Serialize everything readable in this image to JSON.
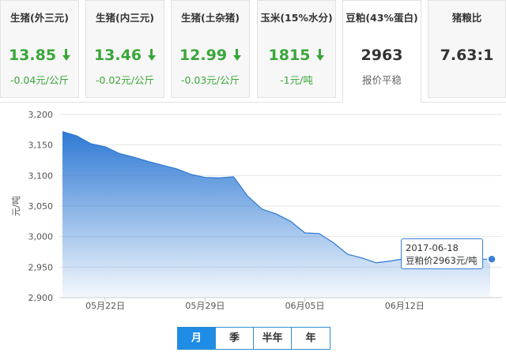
{
  "cards": [
    {
      "title": "生猪(外三元)",
      "value": "13.85",
      "change": "-0.04元/公斤",
      "trend": "down"
    },
    {
      "title": "生猪(内三元)",
      "value": "13.46",
      "change": "-0.02元/公斤",
      "trend": "down"
    },
    {
      "title": "生猪(土杂猪)",
      "value": "12.99",
      "change": "-0.03元/公斤",
      "trend": "down"
    },
    {
      "title": "玉米(15%水分)",
      "value": "1815",
      "change": "-1元/吨",
      "trend": "down"
    },
    {
      "title": "豆粕(43%蛋白)",
      "value": "2963",
      "change": "报价平稳",
      "trend": "flat"
    },
    {
      "title": "猪粮比",
      "value": "7.63:1",
      "change": "",
      "trend": "flat"
    }
  ],
  "tooltip": {
    "date": "2017-06-18",
    "text": "豆粕价2963元/吨"
  },
  "range_tabs": [
    "月",
    "季",
    "半年",
    "年"
  ],
  "colors": {
    "accent": "#1f8ce6",
    "down": "#3aa63a",
    "area_top": "#3580d8"
  },
  "chart_data": {
    "type": "area",
    "title": "",
    "xlabel": "",
    "ylabel": "元/吨",
    "ylim": [
      2900,
      3200
    ],
    "yticks": [
      2900,
      2950,
      3000,
      3050,
      3100,
      3150,
      3200
    ],
    "ytick_labels": [
      "2,900",
      "2,950",
      "3,000",
      "3,050",
      "3,100",
      "3,150",
      "3,200"
    ],
    "xticks": [
      {
        "label": "05月22日",
        "date": "2017-05-22"
      },
      {
        "label": "05月29日",
        "date": "2017-05-29"
      },
      {
        "label": "06月05日",
        "date": "2017-06-05"
      },
      {
        "label": "06月12日",
        "date": "2017-06-12"
      }
    ],
    "series": [
      {
        "name": "豆粕价",
        "x": [
          "2017-05-19",
          "2017-05-20",
          "2017-05-21",
          "2017-05-22",
          "2017-05-23",
          "2017-05-24",
          "2017-05-25",
          "2017-05-26",
          "2017-05-27",
          "2017-05-28",
          "2017-05-29",
          "2017-05-30",
          "2017-05-31",
          "2017-06-01",
          "2017-06-02",
          "2017-06-03",
          "2017-06-04",
          "2017-06-05",
          "2017-06-06",
          "2017-06-07",
          "2017-06-08",
          "2017-06-09",
          "2017-06-10",
          "2017-06-11",
          "2017-06-12",
          "2017-06-13",
          "2017-06-14",
          "2017-06-15",
          "2017-06-16",
          "2017-06-17",
          "2017-06-18"
        ],
        "values": [
          3172,
          3165,
          3152,
          3147,
          3136,
          3130,
          3123,
          3117,
          3111,
          3102,
          3097,
          3096,
          3098,
          3066,
          3045,
          3037,
          3025,
          3006,
          3005,
          2990,
          2971,
          2965,
          2957,
          2960,
          2964,
          2963,
          2963,
          2963,
          2963,
          2963,
          2963
        ]
      }
    ],
    "grid": true,
    "highlight": {
      "date": "2017-06-18",
      "value": 2963
    }
  }
}
